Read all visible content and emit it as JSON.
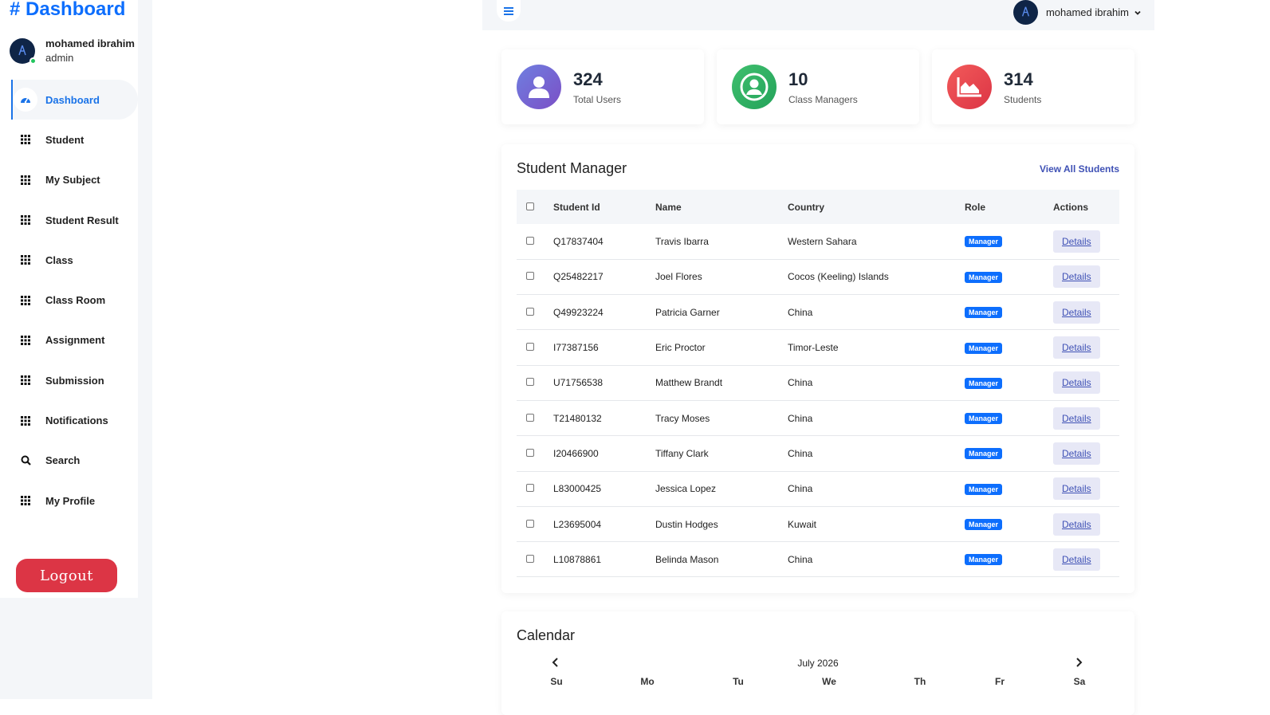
{
  "sidebar": {
    "brand": "# Dashboard",
    "user": {
      "name": "mohamed ibrahim",
      "role": "admin"
    },
    "items": [
      {
        "label": "Dashboard",
        "icon": "dashboard-icon",
        "active": true
      },
      {
        "label": "Student",
        "icon": "grid-icon"
      },
      {
        "label": "My Subject",
        "icon": "grid-icon"
      },
      {
        "label": "Student Result",
        "icon": "grid-icon"
      },
      {
        "label": "Class",
        "icon": "grid-icon"
      },
      {
        "label": "Class Room",
        "icon": "grid-icon"
      },
      {
        "label": "Assignment",
        "icon": "grid-icon"
      },
      {
        "label": "Submission",
        "icon": "grid-icon"
      },
      {
        "label": "Notifications",
        "icon": "grid-icon"
      },
      {
        "label": "Search",
        "icon": "search-icon"
      },
      {
        "label": "My Profile",
        "icon": "grid-icon"
      }
    ],
    "logout_label": "Logout"
  },
  "topbar": {
    "user_name": "mohamed ibrahim"
  },
  "stats": [
    {
      "value": "324",
      "label": "Total Users",
      "icon": "user-icon",
      "color": "#6f42c1"
    },
    {
      "value": "10",
      "label": "Class Managers",
      "icon": "user-circle-icon",
      "color": "#28a745"
    },
    {
      "value": "314",
      "label": "Students",
      "icon": "area-chart-icon",
      "color": "#dc3545"
    }
  ],
  "student_manager": {
    "title": "Student Manager",
    "view_all": "View All Students",
    "columns": [
      "Student Id",
      "Name",
      "Country",
      "Role",
      "Actions"
    ],
    "rows": [
      {
        "id": "Q17837404",
        "name": "Travis Ibarra",
        "country": "Western Sahara",
        "role": "Manager",
        "action": "Details"
      },
      {
        "id": "Q25482217",
        "name": "Joel Flores",
        "country": "Cocos (Keeling) Islands",
        "role": "Manager",
        "action": "Details"
      },
      {
        "id": "Q49923224",
        "name": "Patricia Garner",
        "country": "China",
        "role": "Manager",
        "action": "Details"
      },
      {
        "id": "I77387156",
        "name": "Eric Proctor",
        "country": "Timor-Leste",
        "role": "Manager",
        "action": "Details"
      },
      {
        "id": "U71756538",
        "name": "Matthew Brandt",
        "country": "China",
        "role": "Manager",
        "action": "Details"
      },
      {
        "id": "T21480132",
        "name": "Tracy Moses",
        "country": "China",
        "role": "Manager",
        "action": "Details"
      },
      {
        "id": "I20466900",
        "name": "Tiffany Clark",
        "country": "China",
        "role": "Manager",
        "action": "Details"
      },
      {
        "id": "L83000425",
        "name": "Jessica Lopez",
        "country": "China",
        "role": "Manager",
        "action": "Details"
      },
      {
        "id": "L23695004",
        "name": "Dustin Hodges",
        "country": "Kuwait",
        "role": "Manager",
        "action": "Details"
      },
      {
        "id": "L10878861",
        "name": "Belinda Mason",
        "country": "China",
        "role": "Manager",
        "action": "Details"
      }
    ]
  },
  "calendar": {
    "title": "Calendar",
    "month": "July 2026",
    "weekdays": [
      "Su",
      "Mo",
      "Tu",
      "We",
      "Th",
      "Fr",
      "Sa"
    ]
  },
  "colors": {
    "accent": "#1a73e8",
    "logout": "#dc3545",
    "badge": "#0d6efd",
    "link": "#3f51b5"
  }
}
